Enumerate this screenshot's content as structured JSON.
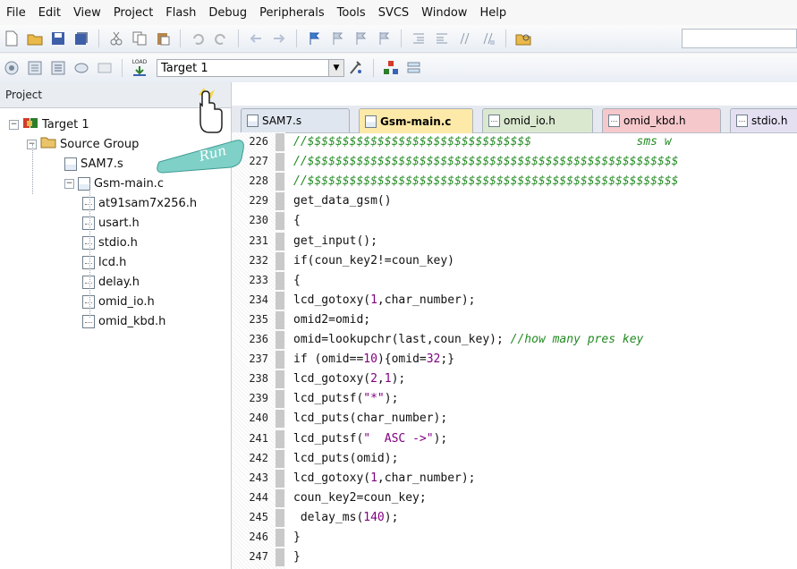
{
  "menu": [
    "File",
    "Edit",
    "View",
    "Project",
    "Flash",
    "Debug",
    "Peripherals",
    "Tools",
    "SVCS",
    "Window",
    "Help"
  ],
  "toolbar": {
    "target_value": "Target 1",
    "run_tooltip": "Run",
    "load_label": "LOAD"
  },
  "project": {
    "header": "Project",
    "tree": [
      {
        "label": "Target 1",
        "level": 0,
        "type": "target",
        "expander": "−"
      },
      {
        "label": "Source Group",
        "level": 1,
        "type": "folder",
        "expander": "−"
      },
      {
        "label": "SAM7.s",
        "level": 2,
        "type": "c",
        "expander": ""
      },
      {
        "label": "Gsm-main.c",
        "level": 2,
        "type": "c",
        "expander": "−"
      },
      {
        "label": "at91sam7x256.h",
        "level": 3,
        "type": "h",
        "expander": ""
      },
      {
        "label": "usart.h",
        "level": 3,
        "type": "h",
        "expander": ""
      },
      {
        "label": "stdio.h",
        "level": 3,
        "type": "h",
        "expander": ""
      },
      {
        "label": "lcd.h",
        "level": 3,
        "type": "h",
        "expander": ""
      },
      {
        "label": "delay.h",
        "level": 3,
        "type": "h",
        "expander": ""
      },
      {
        "label": "omid_io.h",
        "level": 3,
        "type": "h",
        "expander": ""
      },
      {
        "label": "omid_kbd.h",
        "level": 3,
        "type": "h",
        "expander": ""
      }
    ]
  },
  "tabs": [
    {
      "label": "SAM7.s",
      "color": "#dfe6ef",
      "active": false
    },
    {
      "label": "Gsm-main.c",
      "color": "#fde9a8",
      "active": true
    },
    {
      "label": "omid_io.h",
      "color": "#dbe8d0",
      "active": false
    },
    {
      "label": "omid_kbd.h",
      "color": "#f5c8cc",
      "active": false
    },
    {
      "label": "stdio.h",
      "color": "#e4e0f2",
      "active": false
    }
  ],
  "code_lines": [
    {
      "n": "226",
      "t": "//$$$$$$$$$$$$$$$$$$$$$$$$$$$$$$$$               sms w"
    },
    {
      "n": "227",
      "t": "//$$$$$$$$$$$$$$$$$$$$$$$$$$$$$$$$$$$$$$$$$$$$$$$$$$$$$"
    },
    {
      "n": "228",
      "t": "//$$$$$$$$$$$$$$$$$$$$$$$$$$$$$$$$$$$$$$$$$$$$$$$$$$$$$"
    },
    {
      "n": "229",
      "t": "get_data_gsm()"
    },
    {
      "n": "230",
      "t": "{"
    },
    {
      "n": "231",
      "t": "get_input();"
    },
    {
      "n": "232",
      "t": "if(coun_key2!=coun_key)"
    },
    {
      "n": "233",
      "t": "{"
    },
    {
      "n": "234",
      "t": "lcd_gotoxy(1,char_number);"
    },
    {
      "n": "235",
      "t": "omid2=omid;"
    },
    {
      "n": "236",
      "t": "omid=lookupchr(last,coun_key); //how many pres key"
    },
    {
      "n": "237",
      "t": "if (omid==10){omid=32;}"
    },
    {
      "n": "238",
      "t": "lcd_gotoxy(2,1);"
    },
    {
      "n": "239",
      "t": "lcd_putsf(\"*\");"
    },
    {
      "n": "240",
      "t": "lcd_puts(char_number);"
    },
    {
      "n": "241",
      "t": "lcd_putsf(\"  ASC ->\");"
    },
    {
      "n": "242",
      "t": "lcd_puts(omid);"
    },
    {
      "n": "243",
      "t": "lcd_gotoxy(1,char_number);"
    },
    {
      "n": "244",
      "t": "coun_key2=coun_key;"
    },
    {
      "n": "245",
      "t": " delay_ms(140);"
    },
    {
      "n": "246",
      "t": "}"
    },
    {
      "n": "247",
      "t": "}"
    }
  ]
}
